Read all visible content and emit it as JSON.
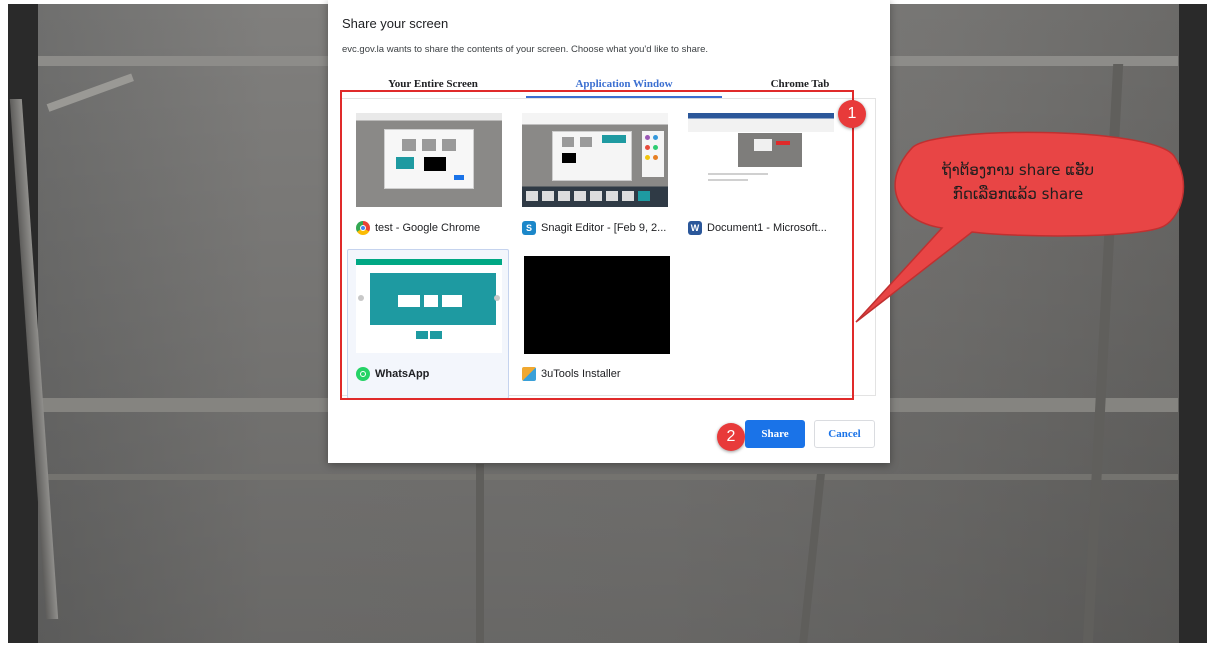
{
  "dialog": {
    "title": "Share your screen",
    "subtitle": "evc.gov.la wants to share the contents of your screen. Choose what you'd like to share.",
    "tabs": [
      {
        "label": "Your Entire Screen",
        "active": false
      },
      {
        "label": "Application Window",
        "active": true
      },
      {
        "label": "Chrome Tab",
        "active": false
      }
    ],
    "windows": [
      {
        "label": "test - Google Chrome",
        "icon": "chrome-icon",
        "selected": false
      },
      {
        "label": "Snagit Editor - [Feb 9, 2...",
        "icon": "snagit-icon",
        "selected": false
      },
      {
        "label": "Document1 - Microsoft...",
        "icon": "word-icon",
        "selected": false
      },
      {
        "label": "WhatsApp",
        "icon": "whatsapp-icon",
        "selected": true
      },
      {
        "label": "3uTools Installer",
        "icon": "3utools-icon",
        "selected": false
      }
    ],
    "share_label": "Share",
    "cancel_label": "Cancel"
  },
  "annotations": {
    "badge_1": "1",
    "badge_2": "2",
    "callout_line1": "ຖ້າຕ້ອງການ share ແອັບ",
    "callout_line2": "ກົດເລືອກແລ້ວ share"
  },
  "icons": {
    "app_window_thumb_word_letter": "W",
    "snagit_letter": "S"
  },
  "colors": {
    "accent": "#1a73e8",
    "active_tab": "#3b6fd1",
    "annotation_red": "#e02a2a",
    "whatsapp_green": "#25d366",
    "whatsapp_teal": "#1e9aa1"
  }
}
